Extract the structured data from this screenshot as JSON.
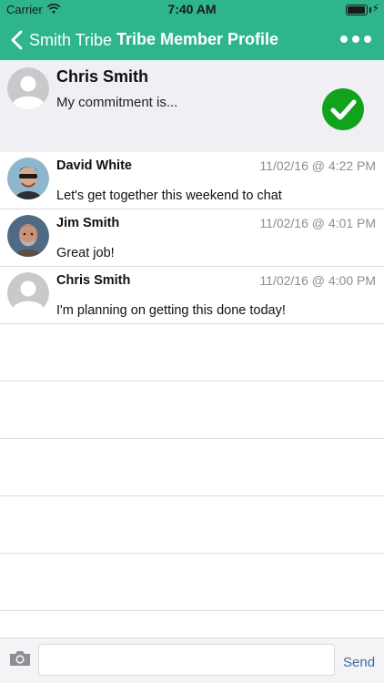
{
  "status_bar": {
    "carrier": "Carrier",
    "time": "7:40 AM",
    "battery_level": 0.95
  },
  "nav": {
    "back_label": "Smith Tribe",
    "title": "Tribe Member Profile"
  },
  "profile": {
    "name": "Chris Smith",
    "commitment": "My commitment is...",
    "completed": true
  },
  "messages": [
    {
      "sender": "David White",
      "timestamp": "11/02/16 @ 4:22 PM",
      "text": "Let's get together this weekend to chat",
      "avatar": "photo"
    },
    {
      "sender": "Jim Smith",
      "timestamp": "11/02/16 @ 4:01 PM",
      "text": "Great job!",
      "avatar": "photo"
    },
    {
      "sender": "Chris Smith",
      "timestamp": "11/02/16 @ 4:00 PM",
      "text": "I'm planning on getting this done today!",
      "avatar": "placeholder"
    }
  ],
  "composer": {
    "input_value": "",
    "send_label": "Send"
  },
  "colors": {
    "nav_green": "#2fb58c",
    "check_green": "#12a31c",
    "send_blue": "#3c6f9c"
  }
}
